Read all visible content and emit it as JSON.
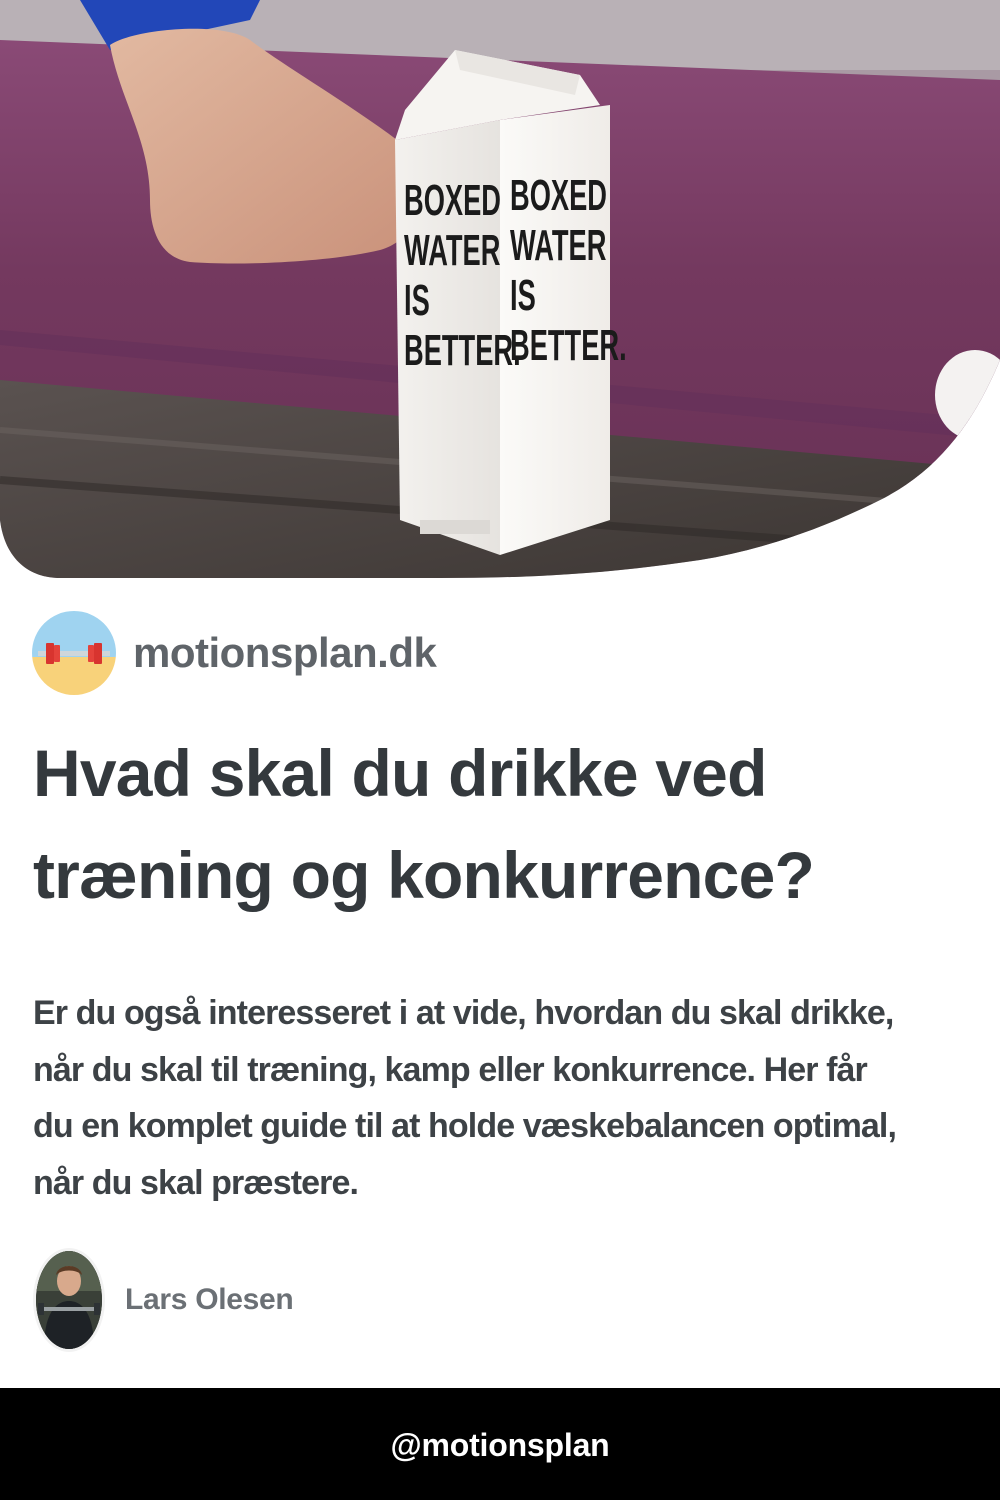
{
  "hero": {
    "carton_lines": [
      "BOXED",
      "WATER",
      "IS",
      "BETTER."
    ]
  },
  "site": {
    "name": "motionsplan.dk",
    "logo_icon": "barbell-beach-icon"
  },
  "article": {
    "title_line1": "Hvad skal du drikke ved",
    "title_line2": "træning og konkurrence?",
    "description_lines": [
      "Er du også interesseret i at vide, hvordan du skal drikke,",
      "når du skal til træning, kamp eller konkurrence. Her får",
      "du en komplet guide til at holde væskebalancen optimal,",
      "når du skal præstere."
    ]
  },
  "author": {
    "name": "Lars Olesen"
  },
  "footer": {
    "handle": "@motionsplan"
  },
  "colors": {
    "title": "#34393d",
    "text": "#3d4246",
    "muted": "#5f6469",
    "footer_bg": "#000000",
    "mat": "#7a3f69"
  }
}
